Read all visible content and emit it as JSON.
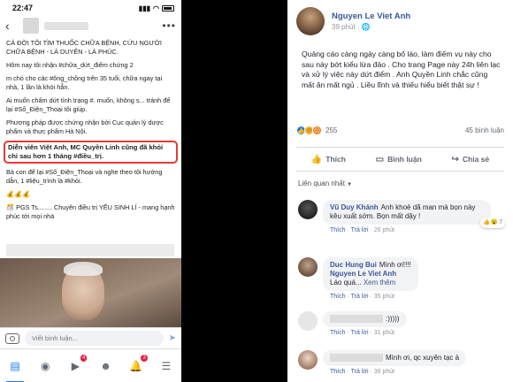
{
  "phone": {
    "time": "22:47",
    "post_paragraphs": [
      "CÁ ĐỜI TÔI TÌM THUỐC CHỮA BỆNH, CỨU NGƯỜI CHỮA BỆNH - LÀ DUYÊN - LÀ PHÚC.",
      "Hôm nay tôi nhận #chữa_dứt_điểm chứng 2",
      "m chó cho các #ông_chồng trên 35 tuổi, chữa ngay tại nhà, 1 lần là khỏi hẳn.",
      "Ai muốn chấm dứt tình trạng #. muốn, không s... tránh để lại #Số_Điện_Thoại tôi giúp.",
      "Phương pháp được chứng nhận bởi Cục quản lý dược phẩm và thực phẩm Hà Nội."
    ],
    "highlight_text": "Diễn viên Việt Anh, MC Quyền Linh cũng đã khỏi chỉ sau hơn 1 tháng #điều_trị.",
    "post_paragraphs_2": [
      "Bà con để lại #Số_Điện_Thoại và nghe theo tôi hướng dẫn, 1 #liệu_trình là #khỏi.",
      "💰💰💰",
      "🎊 PGS Ts........ Chuyên điều trị YẾU SINH LÍ - mang hạnh phúc tới mọi nhà"
    ],
    "comment_placeholder": "Viết bình luận...",
    "tabs": [
      {
        "icon": "news-feed-icon",
        "glyph": "▤",
        "badge": ""
      },
      {
        "icon": "profile-icon",
        "glyph": "◉",
        "badge": ""
      },
      {
        "icon": "video-icon",
        "glyph": "▶",
        "badge": "4"
      },
      {
        "icon": "groups-icon",
        "glyph": "☻",
        "badge": ""
      },
      {
        "icon": "notifications-icon",
        "glyph": "🔔",
        "badge": "3"
      },
      {
        "icon": "menu-icon",
        "glyph": "☰",
        "badge": ""
      }
    ]
  },
  "post": {
    "author": "Nguyen Le Viet Anh",
    "time": "39 phút · 🌐",
    "body": "Quảng cáo càng ngày càng bố láo, làm điếm vụ này cho sau này bớt kiểu lừa đảo . Cho trang Page này 24h liên lạc và xử lý việc này dứt điểm . Anh Quyền Linh chắc cũng mất ăn mất ngủ . Liều lĩnh và thiếu hiểu biết thật sự !",
    "reaction_count": "255",
    "comments_count": "45 bình luận",
    "actions": {
      "like": "Thích",
      "comment": "Bình luận",
      "share": "Chia sẻ"
    },
    "related_label": "Liên quan nhất"
  },
  "comments": [
    {
      "name": "Vũ Duy Khánh",
      "text": "Anh khoẻ dã man mà bọn này kêu xuất sớm. Bọn mất dậy !",
      "meta_like": "Thích",
      "meta_reply": "Trả lời",
      "meta_time": "26 phút",
      "badge": "7"
    },
    {
      "name": "Duc Hung Bui",
      "text": "Mình ơi!!!!",
      "meta_like": "Thích",
      "meta_reply": "Trả lời",
      "meta_time": "35 phút",
      "reply_name": "Nguyen Le Viet Anh",
      "reply_text": "Láo quá...",
      "reply_more": "Xem thêm"
    },
    {
      "name": "",
      "text": ":)))))",
      "meta_like": "Thích",
      "meta_reply": "Trả lời",
      "meta_time": "31 phút"
    },
    {
      "name": "",
      "text": "Mình ơi, qc xuyên tạc à",
      "meta_like": "Thích",
      "meta_reply": "Trả lời",
      "meta_time": "36 phút"
    }
  ]
}
